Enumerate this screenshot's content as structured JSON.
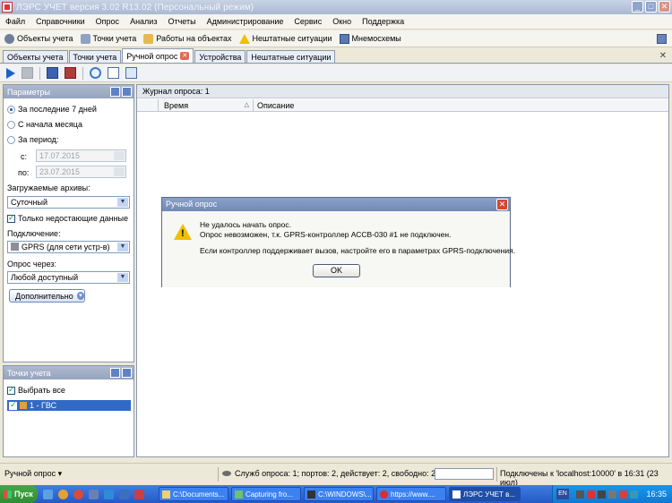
{
  "window": {
    "title": "ЛЭРС УЧЕТ версия 3.02 R13.02 (Персональный режим)"
  },
  "menu": [
    "Файл",
    "Справочники",
    "Опрос",
    "Анализ",
    "Отчеты",
    "Администрирование",
    "Сервис",
    "Окно",
    "Поддержка"
  ],
  "nav": {
    "objects": "Объекты учета",
    "points": "Точки учета",
    "works": "Работы на объектах",
    "emergency": "Нештатные ситуации",
    "schemes": "Мнемосхемы"
  },
  "tabs": {
    "objects": "Объекты учета",
    "points": "Точки учета",
    "manual": "Ручной опрос",
    "devices": "Устройства",
    "emergency": "Нештатные ситуации"
  },
  "params": {
    "header": "Параметры",
    "last7": "За последние 7 дней",
    "month_start": "С начала месяца",
    "period": "За период:",
    "from_lbl": "с:",
    "from_val": "17.07.2015",
    "to_lbl": "по:",
    "to_val": "23.07.2015",
    "archives_lbl": "Загружаемые архивы:",
    "archives_val": "Суточный",
    "only_missing": "Только недостающие данные",
    "connection_lbl": "Подключение:",
    "connection_val": "GPRS (для сети устр-в)",
    "via_lbl": "Опрос через:",
    "via_val": "Любой доступный",
    "more": "Дополнительно"
  },
  "points_panel": {
    "header": "Точки учета",
    "select_all": "Выбрать все",
    "item": "1 - ГВС"
  },
  "journal": {
    "title": "Журнал опроса: 1",
    "col_time": "Время",
    "col_desc": "Описание"
  },
  "dialog": {
    "title": "Ручной опрос",
    "line1": "Не удалось начать опрос.",
    "line2": "Опрос невозможен, т.к. GPRS-контроллер АССВ-030 #1 не подключен.",
    "line3": "Если контроллер поддерживает вызов, настройте его в параметрах GPRS-подключения.",
    "ok": "OK"
  },
  "status": {
    "left": "Ручной опрос ▾",
    "mid": "Служб опроса: 1; портов: 2, действует: 2, свободно: 2",
    "right": "Подключены к 'localhost:10000' в 16:31 (23 июл)"
  },
  "taskbar": {
    "start": "Пуск",
    "tasks": [
      "C:\\Documents...",
      "Capturing fro...",
      "C:\\WINDOWS\\...",
      "https://www....",
      "ЛЭРС УЧЕТ в..."
    ],
    "lang": "EN",
    "clock": "16:35"
  }
}
